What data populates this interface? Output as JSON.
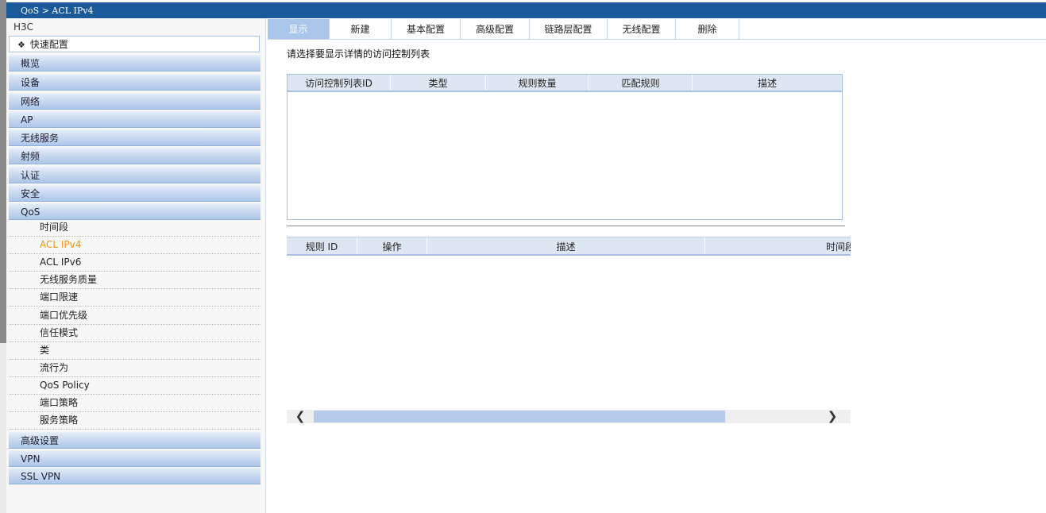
{
  "breadcrumb": "QoS > ACL IPv4",
  "sidebar": {
    "brand": "H3C",
    "quick_config": {
      "icon": "diamond-bullet-icon",
      "glyph": "❖",
      "label": "快速配置"
    },
    "groups_top": [
      {
        "label": "概览"
      },
      {
        "label": "设备"
      },
      {
        "label": "网络"
      },
      {
        "label": "AP"
      },
      {
        "label": "无线服务"
      },
      {
        "label": "射频"
      },
      {
        "label": "认证"
      },
      {
        "label": "安全"
      },
      {
        "label": "QoS"
      }
    ],
    "qos_items": [
      {
        "label": "时间段"
      },
      {
        "label": "ACL IPv4"
      },
      {
        "label": "ACL IPv6"
      },
      {
        "label": "无线服务质量"
      },
      {
        "label": "端口限速"
      },
      {
        "label": "端口优先级"
      },
      {
        "label": "信任模式"
      },
      {
        "label": "类"
      },
      {
        "label": "流行为"
      },
      {
        "label": "QoS Policy"
      },
      {
        "label": "端口策略"
      },
      {
        "label": "服务策略"
      }
    ],
    "active_item": "ACL IPv4",
    "groups_bottom": [
      {
        "label": "高级设置"
      },
      {
        "label": "VPN"
      },
      {
        "label": "SSL VPN"
      }
    ]
  },
  "tabs": [
    {
      "label": "显示"
    },
    {
      "label": "新建"
    },
    {
      "label": "基本配置"
    },
    {
      "label": "高级配置"
    },
    {
      "label": "链路层配置"
    },
    {
      "label": "无线配置"
    },
    {
      "label": "删除"
    }
  ],
  "active_tab": "显示",
  "main": {
    "prompt": "请选择要显示详情的访问控制列表",
    "acl_table": {
      "columns": [
        "访问控制列表ID",
        "类型",
        "规则数量",
        "匹配规则",
        "描述"
      ],
      "rows": []
    },
    "rule_table": {
      "columns": [
        "规则 ID",
        "操作",
        "描述",
        "时间段"
      ],
      "rows": []
    },
    "scrollbar": {
      "left_icon": "chevron-left-icon",
      "right_icon": "chevron-right-icon",
      "left_glyph": "❮",
      "right_glyph": "❯"
    }
  },
  "colors": {
    "header_bar": "#1b5a9a",
    "active_tab": "#aac6ea",
    "active_menu_item": "#e89a0e",
    "nav_group_gradient_bottom": "#adc6ea"
  }
}
